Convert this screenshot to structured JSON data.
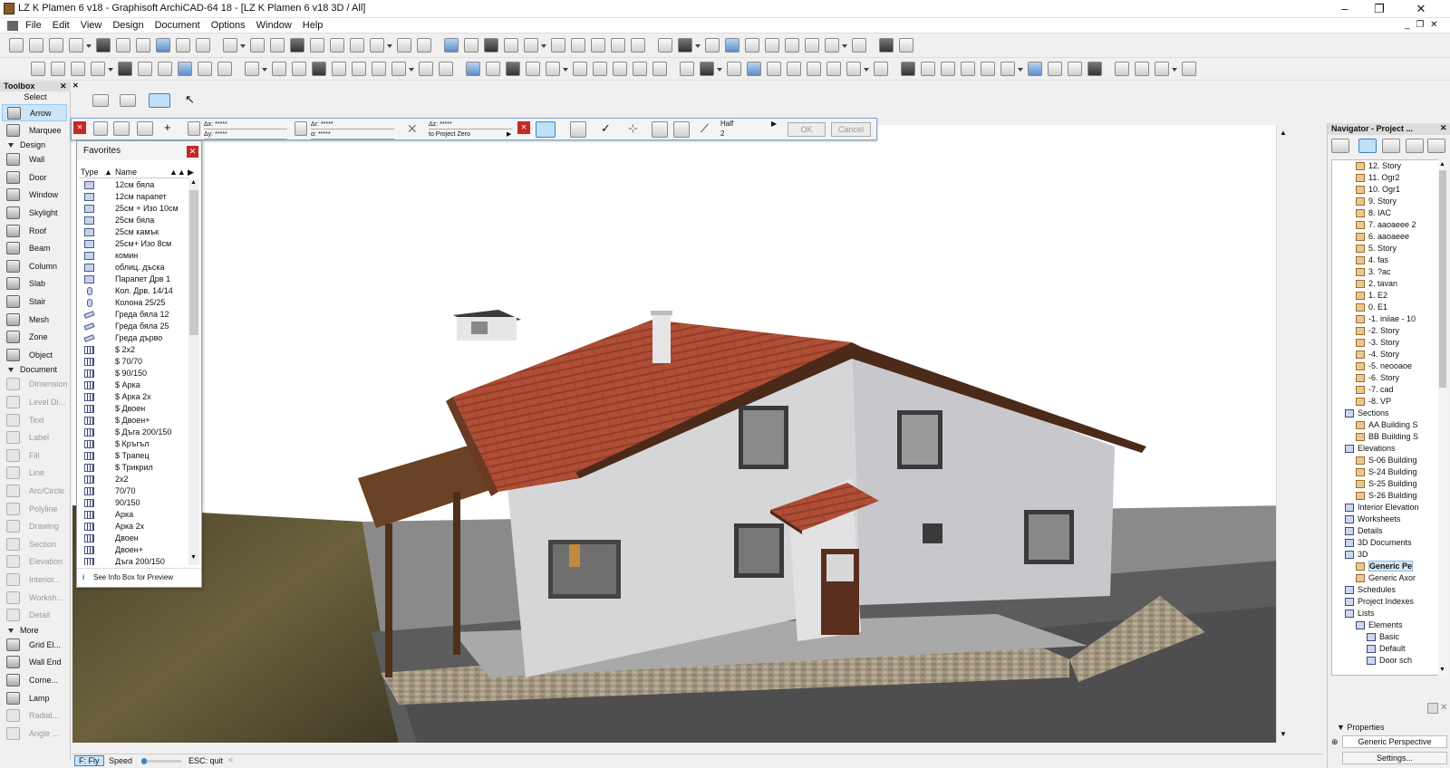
{
  "window": {
    "title": "LZ K Plamen 6 v18 - Graphisoft ArchiCAD-64 18 - [LZ K Plamen 6 v18 3D / All]",
    "minimize_glyph": "–",
    "restore_glyph": "❐",
    "close_glyph": "✕"
  },
  "menu": [
    "File",
    "Edit",
    "View",
    "Design",
    "Document",
    "Options",
    "Window",
    "Help"
  ],
  "menu_right_glyphs": "_ ❐ ✕",
  "toolbox": {
    "title": "Toolbox",
    "close_glyph": "✕",
    "select_label": "Select",
    "select_items": [
      {
        "label": "Arrow",
        "selected": true
      },
      {
        "label": "Marquee",
        "selected": false
      }
    ],
    "design_label": "Design",
    "design_items": [
      "Wall",
      "Door",
      "Window",
      "Skylight",
      "Roof",
      "Beam",
      "Column",
      "Slab",
      "Stair",
      "Mesh",
      "Zone",
      "Object"
    ],
    "document_label": "Document",
    "document_items": [
      "Dimension",
      "Level Di...",
      "Text",
      "Label",
      "Fill",
      "Line",
      "Arc/Circle",
      "Polyline",
      "Drawing",
      "Section",
      "Elevation",
      "Interior...",
      "Worksh...",
      "Detail"
    ],
    "more_label": "More",
    "more_items": [
      "Grid El...",
      "Wall End",
      "Corne...",
      "Lamp",
      "Radial...",
      "Angle ..."
    ]
  },
  "infobox": {
    "dx_label": "Δx:",
    "dx_value": "*****",
    "dy_label": "Δy:",
    "dy_value": "*****",
    "dr_label": "Δr:",
    "dr_value": "*****",
    "a_label": "α:",
    "a_value": "*****",
    "dz_label": "Δz:",
    "dz_value": "*****",
    "dz_ref": "to Project Zero",
    "half_label": "Half",
    "half_value": "2",
    "ok_label": "OK",
    "cancel_label": "Cancel"
  },
  "favorites": {
    "title": "Favorites",
    "col_type": "Type",
    "col_name": "Name",
    "items": [
      {
        "name": "12см бяла",
        "kind": "wall"
      },
      {
        "name": "12см парапет",
        "kind": "wall"
      },
      {
        "name": "25см + Изо 10см",
        "kind": "wall"
      },
      {
        "name": "25см бяла",
        "kind": "wall"
      },
      {
        "name": "25см камък",
        "kind": "wall"
      },
      {
        "name": "25см+ Изо 8см",
        "kind": "wall"
      },
      {
        "name": "комин",
        "kind": "wall"
      },
      {
        "name": "облиц. дъска",
        "kind": "wall"
      },
      {
        "name": "Парапет Дрв 1",
        "kind": "wall"
      },
      {
        "name": "Кол. Дрв. 14/14",
        "kind": "column"
      },
      {
        "name": "Колона 25/25",
        "kind": "column"
      },
      {
        "name": "Греда бяла 12",
        "kind": "beam"
      },
      {
        "name": "Греда бяла 25",
        "kind": "beam"
      },
      {
        "name": "Греда дърво",
        "kind": "beam"
      },
      {
        "name": "$ 2x2",
        "kind": "door"
      },
      {
        "name": "$ 70/70",
        "kind": "door"
      },
      {
        "name": "$ 90/150",
        "kind": "door"
      },
      {
        "name": "$ Арка",
        "kind": "door"
      },
      {
        "name": "$ Арка 2x",
        "kind": "door"
      },
      {
        "name": "$ Двоен",
        "kind": "door"
      },
      {
        "name": "$ Двоен+",
        "kind": "door"
      },
      {
        "name": "$ Дъга 200/150",
        "kind": "door"
      },
      {
        "name": "$ Кръгъл",
        "kind": "door"
      },
      {
        "name": "$ Трапец",
        "kind": "door"
      },
      {
        "name": "$ Трикрил",
        "kind": "door"
      },
      {
        "name": "2x2",
        "kind": "door"
      },
      {
        "name": "70/70",
        "kind": "door"
      },
      {
        "name": "90/150",
        "kind": "door"
      },
      {
        "name": "Арка",
        "kind": "door"
      },
      {
        "name": "Арка 2x",
        "kind": "door"
      },
      {
        "name": "Двоен",
        "kind": "door"
      },
      {
        "name": "Двоен+",
        "kind": "door"
      },
      {
        "name": "Дъга 200/150",
        "kind": "door"
      }
    ],
    "footer": "See Info Box for Preview"
  },
  "navigator": {
    "title": "Navigator - Project ...",
    "close_glyph": "✕",
    "nodes": [
      {
        "label": "12. Story",
        "kind": "story",
        "indent": 3
      },
      {
        "label": "11. Ogr2",
        "kind": "story",
        "indent": 3
      },
      {
        "label": "10. Ogr1",
        "kind": "story",
        "indent": 3
      },
      {
        "label": "9. Story",
        "kind": "story",
        "indent": 3
      },
      {
        "label": "8. IAC",
        "kind": "story",
        "indent": 3
      },
      {
        "label": "7. aaoaeee 2",
        "kind": "story",
        "indent": 3
      },
      {
        "label": "6. aaoaeee",
        "kind": "story",
        "indent": 3
      },
      {
        "label": "5. Story",
        "kind": "story",
        "indent": 3
      },
      {
        "label": "4. fas",
        "kind": "story",
        "indent": 3
      },
      {
        "label": "3. ?ac",
        "kind": "story",
        "indent": 3
      },
      {
        "label": "2. tavan",
        "kind": "story",
        "indent": 3
      },
      {
        "label": "1. E2",
        "kind": "story",
        "indent": 3
      },
      {
        "label": "0. E1",
        "kind": "story",
        "indent": 3
      },
      {
        "label": "-1. iniiae - 10",
        "kind": "story",
        "indent": 3
      },
      {
        "label": "-2. Story",
        "kind": "story",
        "indent": 3
      },
      {
        "label": "-3. Story",
        "kind": "story",
        "indent": 3
      },
      {
        "label": "-4. Story",
        "kind": "story",
        "indent": 3
      },
      {
        "label": "-5. neooaoe",
        "kind": "story",
        "indent": 3
      },
      {
        "label": "-6. Story",
        "kind": "story",
        "indent": 3
      },
      {
        "label": "-7. cad",
        "kind": "story",
        "indent": 3
      },
      {
        "label": "-8. VP",
        "kind": "story",
        "indent": 3
      },
      {
        "label": "Sections",
        "kind": "cat",
        "indent": 2
      },
      {
        "label": "AA Building S",
        "kind": "story",
        "indent": 3
      },
      {
        "label": "BB Building S",
        "kind": "story",
        "indent": 3
      },
      {
        "label": "Elevations",
        "kind": "cat",
        "indent": 2
      },
      {
        "label": "S-06 Building",
        "kind": "story",
        "indent": 3
      },
      {
        "label": "S-24 Building",
        "kind": "story",
        "indent": 3
      },
      {
        "label": "S-25 Building",
        "kind": "story",
        "indent": 3
      },
      {
        "label": "S-26 Building",
        "kind": "story",
        "indent": 3
      },
      {
        "label": "Interior Elevation",
        "kind": "cat",
        "indent": 2
      },
      {
        "label": "Worksheets",
        "kind": "cat",
        "indent": 2
      },
      {
        "label": "Details",
        "kind": "cat",
        "indent": 2
      },
      {
        "label": "3D Documents",
        "kind": "cat",
        "indent": 2
      },
      {
        "label": "3D",
        "kind": "cat",
        "indent": 2
      },
      {
        "label": "Generic Pe",
        "kind": "story",
        "indent": 3,
        "selected": true
      },
      {
        "label": "Generic Axor",
        "kind": "story",
        "indent": 3
      },
      {
        "label": "Schedules",
        "kind": "cat",
        "indent": 2
      },
      {
        "label": "Project Indexes",
        "kind": "cat",
        "indent": 2
      },
      {
        "label": "Lists",
        "kind": "cat",
        "indent": 2
      },
      {
        "label": "Elements",
        "kind": "cat",
        "indent": 3
      },
      {
        "label": "Basic",
        "kind": "cat",
        "indent": 4
      },
      {
        "label": "Default",
        "kind": "cat",
        "indent": 4
      },
      {
        "label": "Door sch",
        "kind": "cat",
        "indent": 4
      }
    ],
    "properties_label": "Properties",
    "view_name": "Generic Perspective",
    "settings_label": "Settings..."
  },
  "status": {
    "fly": "F: Fly",
    "speed": "Speed",
    "esc": "ESC: quit"
  },
  "colors": {
    "roof": "#b7503a",
    "wall": "#d8d8da",
    "ground": "#5a5a5a",
    "grass": "#5b5233",
    "stone": "#9a8f78",
    "wood": "#5e3d22"
  }
}
